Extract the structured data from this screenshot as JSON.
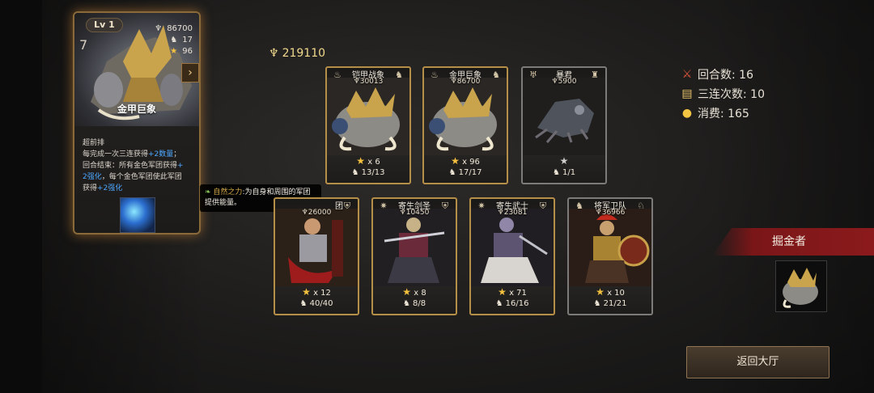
{
  "detail": {
    "level": "Lv 1",
    "cost": "7",
    "power": "86700",
    "attack": "17",
    "stars": "96",
    "name": "金甲巨象",
    "lines": [
      {
        "text": "超前排"
      },
      {
        "text": "每完成一次三连获得",
        "hl": "+2数量",
        "after": "；"
      },
      {
        "text": "回合结束：所有金色军团获得",
        "hl": "+",
        "after": ""
      },
      {
        "text": "",
        "hl": "2强化",
        "after": "，每个金色军团使此军团"
      },
      {
        "text": "获得",
        "hl": "+2强化",
        "after": ""
      }
    ]
  },
  "tooltip": {
    "highlight": "自然之力",
    "text": ":为自身和周围的军团提供能量。"
  },
  "gold_total": "219110",
  "row1": [
    {
      "name": "铠甲战象",
      "power": "30013",
      "stars": "x 6",
      "count": "13/13",
      "tier": "gold"
    },
    {
      "name": "金甲巨象",
      "power": "86700",
      "stars": "x 96",
      "count": "17/17",
      "tier": "gold"
    },
    {
      "name": "暴君",
      "power": "5900",
      "stars": "",
      "count": "1/1",
      "tier": "silver"
    }
  ],
  "row2": [
    {
      "name": "团",
      "power": "26000",
      "stars": "x 12",
      "count": "40/40",
      "tier": "gold"
    },
    {
      "name": "寄生剑圣",
      "power": "10450",
      "stars": "x 8",
      "count": "8/8",
      "tier": "gold"
    },
    {
      "name": "寄生武士",
      "power": "23081",
      "stars": "x 71",
      "count": "16/16",
      "tier": "gold"
    },
    {
      "name": "将军卫队",
      "power": "36966",
      "stars": "x 10",
      "count": "21/21",
      "tier": "silver"
    }
  ],
  "stats": {
    "rounds": "回合数: 16",
    "triples": "三连次数: 10",
    "spent": "消费: 165"
  },
  "opponent": {
    "name": "掘金者"
  },
  "back_button": "返回大厅",
  "colors": {
    "gold": "#b58f48",
    "silver": "#7c7b79",
    "banner_red": "#8b1a1c",
    "highlight_blue": "#4ea8ff"
  }
}
